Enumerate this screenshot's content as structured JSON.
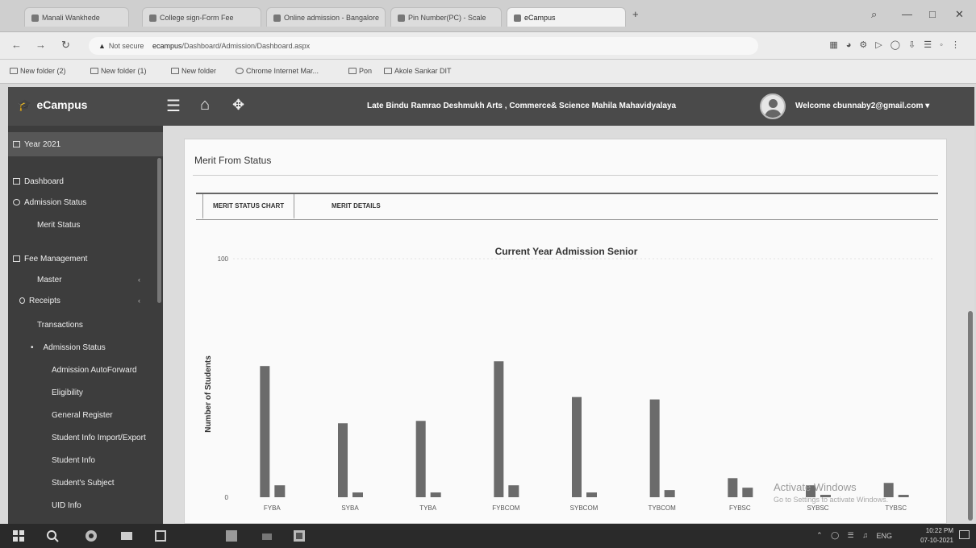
{
  "browser": {
    "tabs": [
      {
        "label": "Manali Wankhede"
      },
      {
        "label": "College sign-Form Fee"
      },
      {
        "label": "Online admission - Bangalore"
      },
      {
        "label": "Pin Number(PC) - Scale"
      },
      {
        "label": "eCampus"
      }
    ],
    "url_warning": "Not secure",
    "url_host": "ecampus",
    "url_path": "/Dashboard/Admission/Dashboard.aspx",
    "bookmarks": [
      "New folder (2)",
      "New folder (1)",
      "New folder",
      "Chrome Internet Mar...",
      "Pon",
      "Akole Sankar DIT"
    ]
  },
  "app": {
    "brand": "eCampus",
    "college": "Late Bindu Ramrao Deshmukh Arts , Commerce& Science Mahila Mahavidyalaya",
    "welcome": "Welcome cbunnaby2@gmail.com ▾"
  },
  "sidebar": {
    "year": "Year 2021",
    "items": [
      {
        "label": "Dashboard"
      },
      {
        "label": "Admission Status"
      },
      {
        "label": "Merit Status"
      },
      {
        "label": "Fee Management"
      },
      {
        "label": "Master"
      },
      {
        "label": "Receipts"
      },
      {
        "label": "Transactions"
      },
      {
        "label": "Admission Status"
      },
      {
        "label": "Admission AutoForward"
      },
      {
        "label": "Eligibility"
      },
      {
        "label": "General Register"
      },
      {
        "label": "Student Info Import/Export"
      },
      {
        "label": "Student Info"
      },
      {
        "label": "Student's Subject"
      },
      {
        "label": "UID Info"
      }
    ]
  },
  "content": {
    "panel_title": "Merit From Status",
    "tabs": [
      "MERIT STATUS CHART",
      "MERIT DETAILS"
    ]
  },
  "chart_data": {
    "type": "bar",
    "title": "Current Year Admission Senior",
    "ylabel": "Number of Students",
    "ylim": [
      0,
      100
    ],
    "yticks": [
      "100",
      "0"
    ],
    "categories": [
      "FYBA",
      "SYBA",
      "TYBA",
      "FYBCOM",
      "SYBCOM",
      "TYBCOM",
      "FYBSC",
      "SYBSC",
      "TYBSC"
    ],
    "series": [
      {
        "values": [
          55,
          31,
          32,
          57,
          42,
          41,
          8,
          5,
          6
        ],
        "color": "#6b6b6b"
      },
      {
        "values": [
          5,
          2,
          2,
          5,
          2,
          3,
          4,
          1,
          1
        ],
        "color": "#6b6b6b"
      }
    ]
  },
  "watermark": {
    "line1": "Activate Windows",
    "line2": "Go to Settings to activate Windows."
  },
  "taskbar": {
    "clock_time": "10:22 PM",
    "clock_date": "07-10-2021",
    "lang": "ENG"
  }
}
